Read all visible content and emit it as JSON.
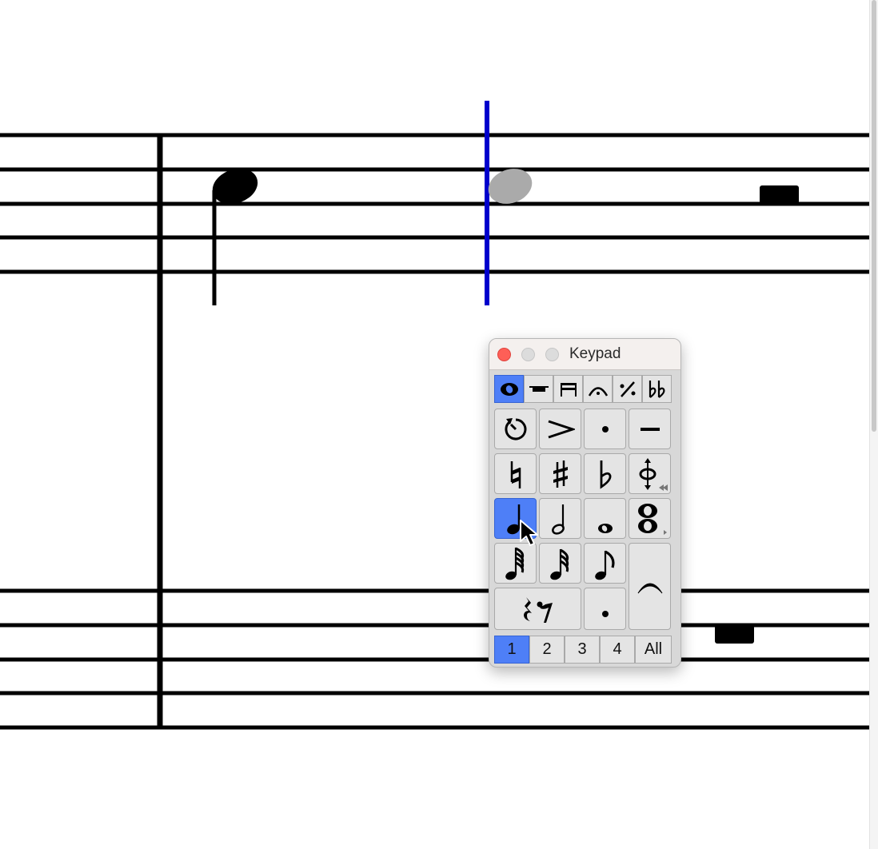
{
  "keypad": {
    "title": "Keypad",
    "layout_tabs": [
      {
        "icon": "common-notes-layout-icon",
        "selected": true
      },
      {
        "icon": "more-notes-layout-icon",
        "selected": false
      },
      {
        "icon": "beams-tremolos-layout-icon",
        "selected": false
      },
      {
        "icon": "articulations-layout-icon",
        "selected": false
      },
      {
        "icon": "jazz-articulations-layout-icon",
        "selected": false
      },
      {
        "icon": "accidentals-layout-icon",
        "selected": false
      }
    ],
    "buttons": [
      {
        "icon": "re-input-pitch-icon",
        "selected": false
      },
      {
        "icon": "accent-icon",
        "selected": false
      },
      {
        "icon": "staccato-icon",
        "selected": false
      },
      {
        "icon": "tenuto-icon",
        "selected": false
      },
      {
        "icon": "natural-icon",
        "selected": false
      },
      {
        "icon": "sharp-icon",
        "selected": false
      },
      {
        "icon": "flat-icon",
        "selected": false
      },
      {
        "icon": "flip-icon",
        "selected": false
      },
      {
        "icon": "quarter-note-icon",
        "selected": true
      },
      {
        "icon": "half-note-icon",
        "selected": false
      },
      {
        "icon": "whole-note-icon",
        "selected": false
      },
      {
        "icon": "double-whole-note-icon",
        "selected": false
      },
      {
        "icon": "sixty-fourth-note-icon",
        "selected": false
      },
      {
        "icon": "thirty-second-note-icon",
        "selected": false
      },
      {
        "icon": "eighth-note-icon",
        "selected": false
      },
      {
        "icon": "tie-icon",
        "selected": false
      },
      {
        "icon": "rest-icon",
        "selected": false
      },
      {
        "icon": "dot-icon",
        "selected": false
      }
    ],
    "voices": [
      {
        "label": "1",
        "selected": true
      },
      {
        "label": "2",
        "selected": false
      },
      {
        "label": "3",
        "selected": false
      },
      {
        "label": "4",
        "selected": false
      },
      {
        "label": "All",
        "selected": false
      }
    ],
    "colors": {
      "selected": "#4e7ff7",
      "close": "#fe5f57"
    }
  },
  "score": {
    "caret_color": "#0000cc",
    "shadow_note_color": "#aaaaaa"
  }
}
